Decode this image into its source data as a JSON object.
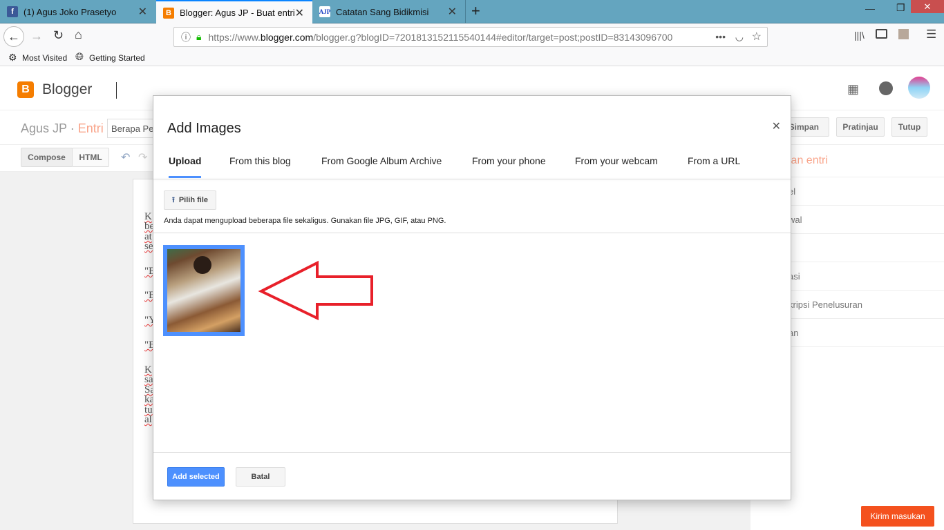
{
  "browser": {
    "tabs": [
      {
        "label": "(1) Agus Joko Prasetyo",
        "icon": "facebook-icon"
      },
      {
        "label": "Blogger: Agus JP - Buat entri",
        "icon": "blogger-icon",
        "active": true
      },
      {
        "label": "Catatan Sang Bidikmisi",
        "icon": "ajp-icon",
        "favicon_text": "AJP"
      }
    ],
    "url_prefix": "https://www.",
    "url_domain": "blogger.com",
    "url_rest": "/blogger.g?blogID=7201813152115540144#editor/target=post;postID=83143096700",
    "bookmarks": [
      "Most Visited",
      "Getting Started"
    ]
  },
  "blogger": {
    "logo_text": "Blogger",
    "accent": "#f57d00"
  },
  "editor": {
    "blog_name": "Agus JP",
    "separator": "·",
    "section": "Entri",
    "title_value": "Berapa Pe",
    "compose_label": "Compose",
    "html_label": "HTML",
    "buttons": {
      "save": "Simpan",
      "preview": "Pratinjau",
      "close": "Tutup"
    },
    "doc_fragments": [
      "K",
      "be",
      "at",
      "se",
      "\"B",
      "\"B",
      "\"Y",
      "\"B",
      "K",
      "sa",
      "Sa",
      "ka",
      "tu",
      "al"
    ]
  },
  "sidebar": {
    "heading": "lan entri",
    "items": [
      "el",
      "wal",
      "t",
      "asi",
      "kripsi Penelusuran",
      "an"
    ]
  },
  "modal": {
    "title": "Add Images",
    "tabs": [
      "Upload",
      "From this blog",
      "From Google Album Archive",
      "From your phone",
      "From your webcam",
      "From a URL"
    ],
    "choose_file": "Pilih file",
    "hint": "Anda dapat mengupload beberapa file sekaligus. Gunakan file JPG, GIF, atau PNG.",
    "add_selected": "Add selected",
    "cancel": "Batal",
    "selection_color": "#4d90fe"
  },
  "feedback": "Kirim masukan"
}
